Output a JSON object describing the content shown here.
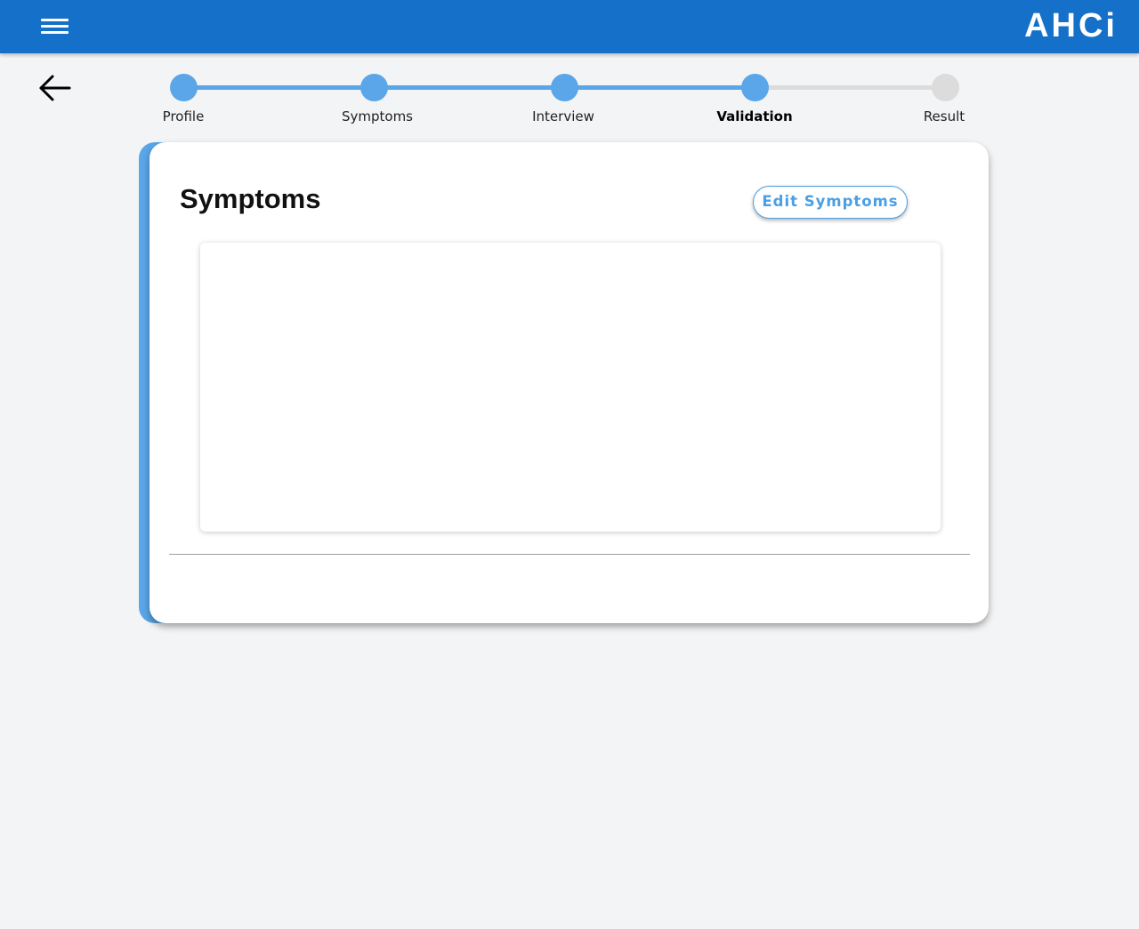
{
  "header": {
    "brand": "AHCi",
    "menu_icon": "hamburger-menu-icon",
    "background_color": "#1570c9"
  },
  "navigation": {
    "back_icon": "arrow-left-icon"
  },
  "stepper": {
    "active_color": "#5aa6e8",
    "inactive_color": "#dcdcdc",
    "current_step": "Validation",
    "steps": [
      {
        "label": "Profile",
        "status": "completed"
      },
      {
        "label": "Symptoms",
        "status": "completed"
      },
      {
        "label": "Interview",
        "status": "completed"
      },
      {
        "label": "Validation",
        "status": "active"
      },
      {
        "label": "Result",
        "status": "pending"
      }
    ]
  },
  "card": {
    "title": "Symptoms",
    "edit_button_label": "Edit Symptoms",
    "accent_color": "#5aa6e8",
    "symptoms": []
  }
}
